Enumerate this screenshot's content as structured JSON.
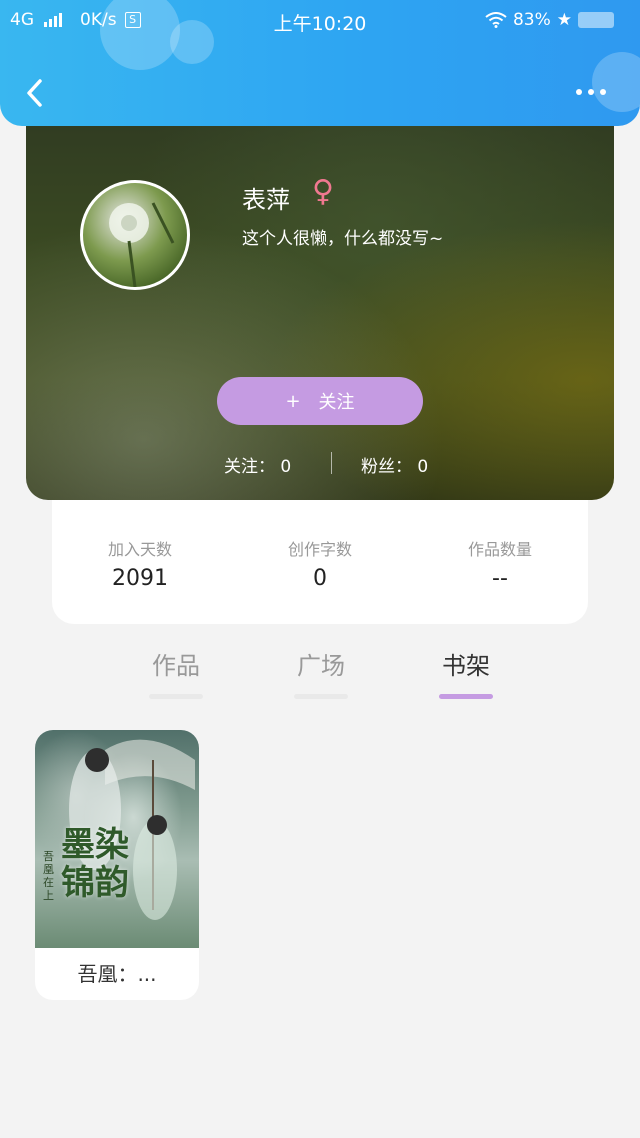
{
  "status_bar": {
    "network": "4G",
    "speed": "0K/s",
    "s_icon": "S",
    "time": "上午10:20",
    "battery": "83%"
  },
  "header": {
    "back_icon": "chevron-left-icon",
    "more_icon": "more-dots-icon"
  },
  "profile": {
    "name": "表萍",
    "gender_symbol": "♀",
    "bio": "这个人很懒，什么都没写~",
    "follow_plus": "+",
    "follow_label": "关注",
    "following_text": "关注： 0",
    "fans_text": "粉丝： 0"
  },
  "stats": [
    {
      "label": "加入天数",
      "value": "2091"
    },
    {
      "label": "创作字数",
      "value": "0"
    },
    {
      "label": "作品数量",
      "value": "--"
    }
  ],
  "tabs": [
    {
      "label": "作品",
      "active": false
    },
    {
      "label": "广场",
      "active": false
    },
    {
      "label": "书架",
      "active": true
    }
  ],
  "books": [
    {
      "title": "吾凰：...",
      "cover_title": "墨染锦韵",
      "cover_author": "吾凰在上"
    }
  ],
  "colors": {
    "accent": "#c59be2",
    "topbar": "#2ea5f2",
    "gender": "#f07890"
  }
}
